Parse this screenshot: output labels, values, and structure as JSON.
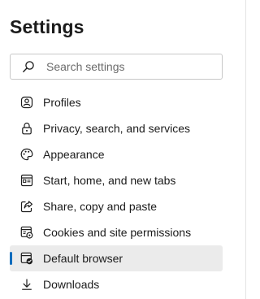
{
  "page": {
    "title": "Settings"
  },
  "search": {
    "placeholder": "Search settings",
    "icon": "search-icon"
  },
  "colors": {
    "accent": "#0f6cbd",
    "selected_bg": "#ebebeb",
    "text": "#1b1b1b",
    "border": "#c8c8c8"
  },
  "sidebar": {
    "items": [
      {
        "label": "Profiles",
        "icon": "profile-icon",
        "selected": false
      },
      {
        "label": "Privacy, search, and services",
        "icon": "lock-icon",
        "selected": false
      },
      {
        "label": "Appearance",
        "icon": "palette-icon",
        "selected": false
      },
      {
        "label": "Start, home, and new tabs",
        "icon": "start-page-icon",
        "selected": false
      },
      {
        "label": "Share, copy and paste",
        "icon": "share-icon",
        "selected": false
      },
      {
        "label": "Cookies and site permissions",
        "icon": "site-permissions-icon",
        "selected": false
      },
      {
        "label": "Default browser",
        "icon": "default-browser-icon",
        "selected": true
      },
      {
        "label": "Downloads",
        "icon": "download-icon",
        "selected": false
      }
    ]
  }
}
